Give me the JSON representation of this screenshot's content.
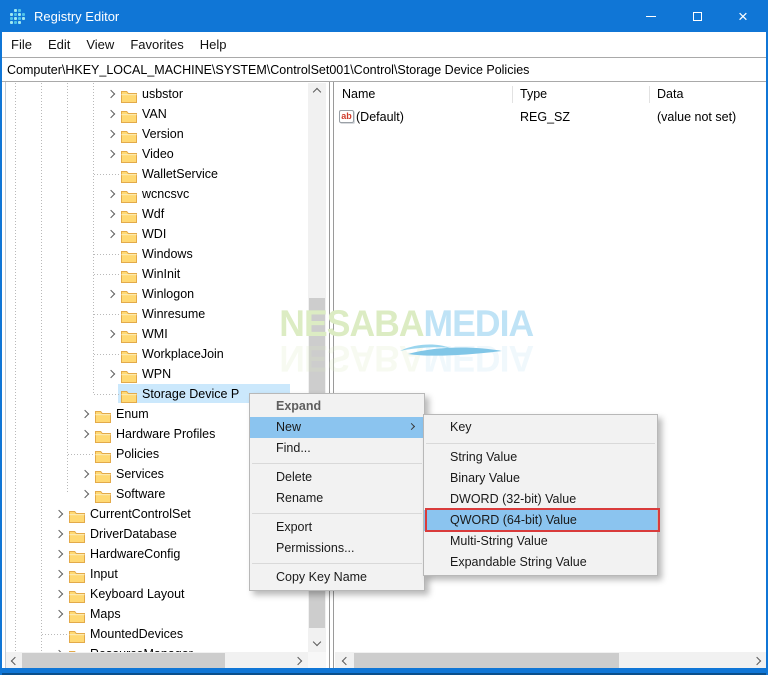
{
  "window": {
    "title": "Registry Editor"
  },
  "menubar": {
    "items": [
      "File",
      "Edit",
      "View",
      "Favorites",
      "Help"
    ]
  },
  "addressbar": {
    "value": "Computer\\HKEY_LOCAL_MACHINE\\SYSTEM\\ControlSet001\\Control\\Storage Device Policies"
  },
  "tree": {
    "items": [
      {
        "label": "usbstor",
        "depth": 5,
        "arrow": true
      },
      {
        "label": "VAN",
        "depth": 5,
        "arrow": true
      },
      {
        "label": "Version",
        "depth": 5,
        "arrow": true
      },
      {
        "label": "Video",
        "depth": 5,
        "arrow": true
      },
      {
        "label": "WalletService",
        "depth": 5,
        "arrow": false
      },
      {
        "label": "wcncsvc",
        "depth": 5,
        "arrow": true
      },
      {
        "label": "Wdf",
        "depth": 5,
        "arrow": true
      },
      {
        "label": "WDI",
        "depth": 5,
        "arrow": true
      },
      {
        "label": "Windows",
        "depth": 5,
        "arrow": false
      },
      {
        "label": "WinInit",
        "depth": 5,
        "arrow": false
      },
      {
        "label": "Winlogon",
        "depth": 5,
        "arrow": true
      },
      {
        "label": "Winresume",
        "depth": 5,
        "arrow": false
      },
      {
        "label": "WMI",
        "depth": 5,
        "arrow": true
      },
      {
        "label": "WorkplaceJoin",
        "depth": 5,
        "arrow": false
      },
      {
        "label": "WPN",
        "depth": 5,
        "arrow": true
      },
      {
        "label": "Storage Device P",
        "depth": 5,
        "arrow": false,
        "selected": true
      },
      {
        "label": "Enum",
        "depth": 4,
        "arrow": true
      },
      {
        "label": "Hardware Profiles",
        "depth": 4,
        "arrow": true
      },
      {
        "label": "Policies",
        "depth": 4,
        "arrow": false
      },
      {
        "label": "Services",
        "depth": 4,
        "arrow": true
      },
      {
        "label": "Software",
        "depth": 4,
        "arrow": true
      },
      {
        "label": "CurrentControlSet",
        "depth": 3,
        "arrow": true
      },
      {
        "label": "DriverDatabase",
        "depth": 3,
        "arrow": true
      },
      {
        "label": "HardwareConfig",
        "depth": 3,
        "arrow": true
      },
      {
        "label": "Input",
        "depth": 3,
        "arrow": true
      },
      {
        "label": "Keyboard Layout",
        "depth": 3,
        "arrow": true
      },
      {
        "label": "Maps",
        "depth": 3,
        "arrow": true
      },
      {
        "label": "MountedDevices",
        "depth": 3,
        "arrow": false
      },
      {
        "label": "ResourceManager",
        "depth": 3,
        "arrow": true,
        "partial": true
      }
    ]
  },
  "list": {
    "columns": [
      "Name",
      "Type",
      "Data"
    ],
    "rows": [
      {
        "icon": "string-value-icon",
        "icon_text": "ab",
        "name": "(Default)",
        "type": "REG_SZ",
        "data": "(value not set)"
      }
    ]
  },
  "context_menu": {
    "items": [
      {
        "label": "Expand",
        "style": "boldgray"
      },
      {
        "label": "New",
        "highlighted": true,
        "has_submenu": true
      },
      {
        "label": "Find..."
      },
      {
        "type": "separator"
      },
      {
        "label": "Delete"
      },
      {
        "label": "Rename"
      },
      {
        "type": "separator"
      },
      {
        "label": "Export"
      },
      {
        "label": "Permissions..."
      },
      {
        "type": "separator"
      },
      {
        "label": "Copy Key Name"
      }
    ]
  },
  "submenu": {
    "items": [
      {
        "label": "Key"
      },
      {
        "type": "separator"
      },
      {
        "label": "String Value"
      },
      {
        "label": "Binary Value"
      },
      {
        "label": "DWORD (32-bit) Value"
      },
      {
        "label": "QWORD (64-bit) Value",
        "highlighted": true,
        "annotated": true
      },
      {
        "label": "Multi-String Value"
      },
      {
        "label": "Expandable String Value"
      }
    ]
  },
  "watermark": {
    "part1": "NESABA",
    "part2": "MEDIA"
  },
  "colors": {
    "titlebar": "#1076d6",
    "selection": "#cbe8fc",
    "menu_highlight": "#8bc4ef",
    "annotation": "#d93b3b",
    "watermark_green": "#dcecc3",
    "watermark_blue": "#bfe3f6",
    "folder_body": "#ffd973",
    "folder_edge": "#e3aa4a"
  }
}
